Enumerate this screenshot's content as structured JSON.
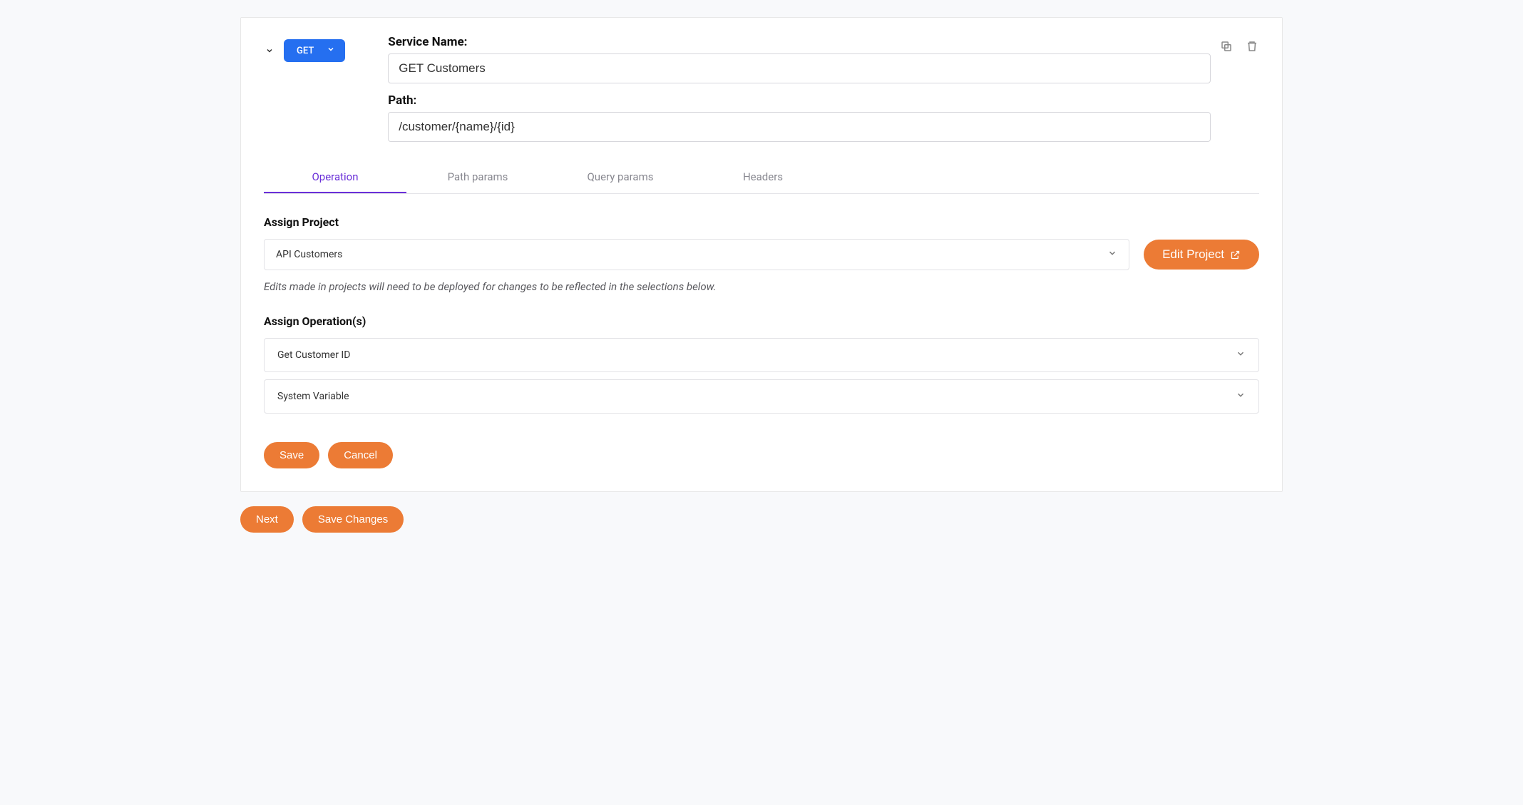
{
  "method": "GET",
  "service_name_label": "Service Name:",
  "service_name_value": "GET Customers",
  "path_label": "Path:",
  "path_value": "/customer/{name}/{id}",
  "tabs": {
    "operation": "Operation",
    "path_params": "Path params",
    "query_params": "Query params",
    "headers": "Headers"
  },
  "assign_project_label": "Assign Project",
  "project_selected": "API Customers",
  "edit_project_label": "Edit Project",
  "project_help": "Edits made in projects will need to be deployed for changes to be reflected in the selections below.",
  "assign_operations_label": "Assign Operation(s)",
  "operations": {
    "op0": "Get Customer ID",
    "op1": "System Variable"
  },
  "buttons": {
    "save": "Save",
    "cancel": "Cancel",
    "next": "Next",
    "save_changes": "Save Changes"
  }
}
